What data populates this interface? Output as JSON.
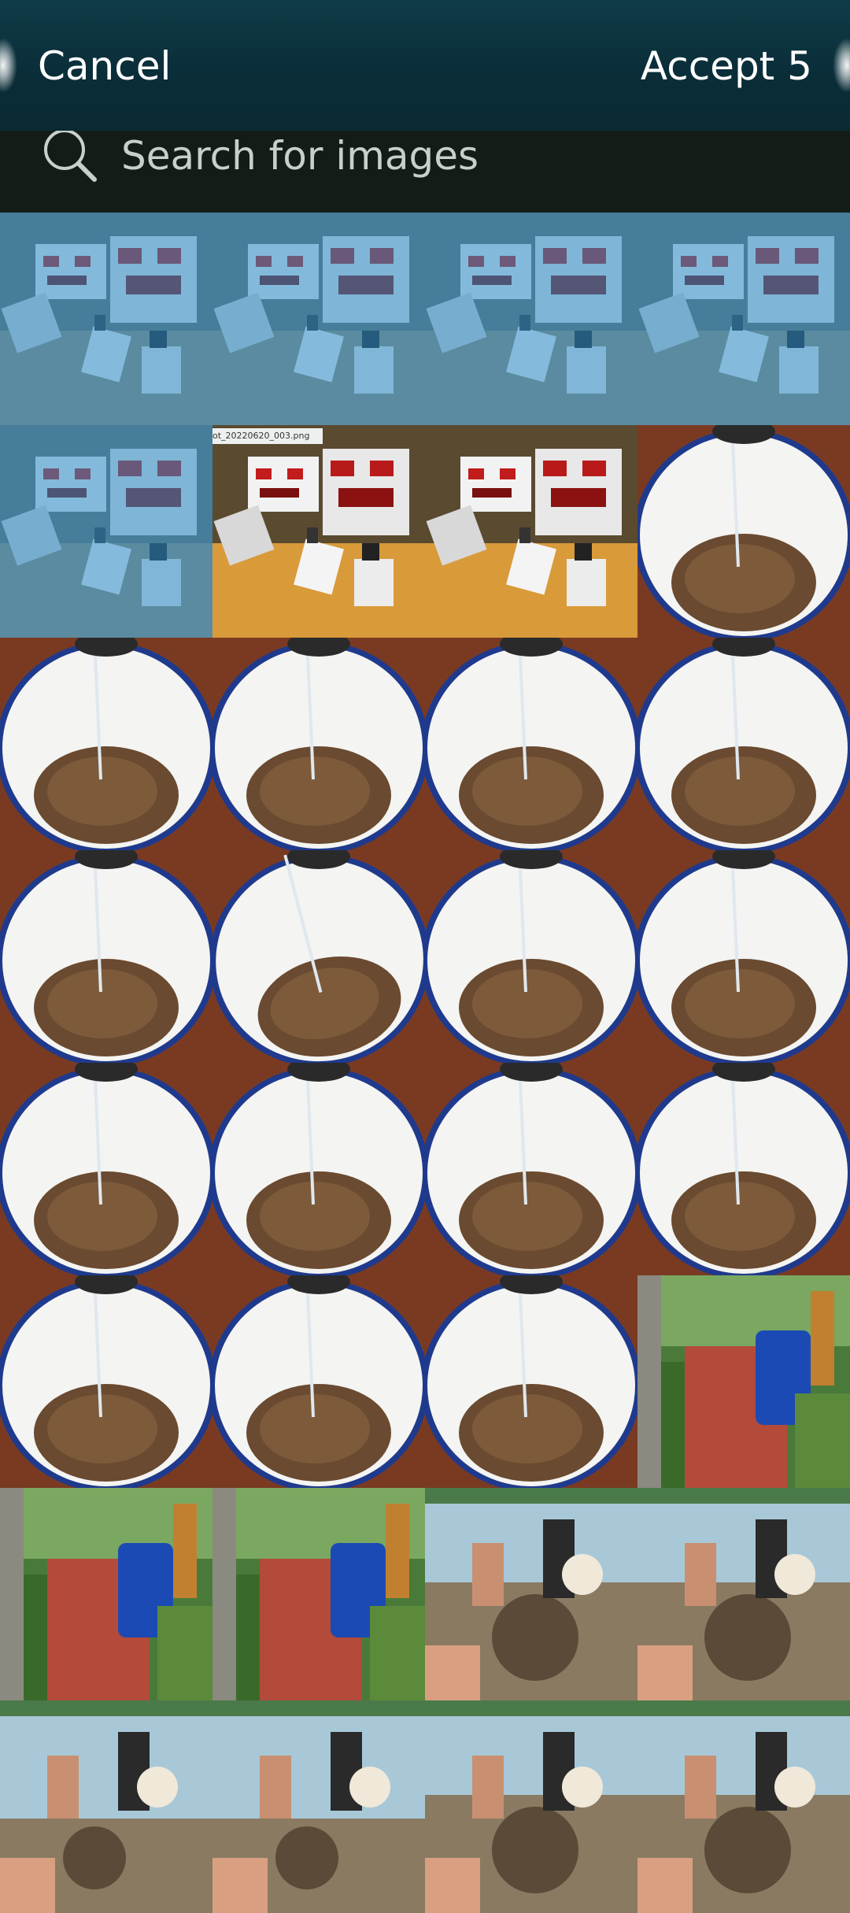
{
  "header": {
    "cancel_label": "Cancel",
    "accept_label": "Accept 5"
  },
  "search": {
    "placeholder": "Search for images",
    "value": ""
  },
  "colors": {
    "selection_overlay": "#2a8cc8",
    "header_bg": "#0f3b48",
    "search_bg": "#141c18"
  },
  "thumbnails": [
    {
      "kind": "lego",
      "selected": true
    },
    {
      "kind": "lego",
      "selected": true
    },
    {
      "kind": "lego",
      "selected": true
    },
    {
      "kind": "lego",
      "selected": true
    },
    {
      "kind": "lego",
      "selected": true
    },
    {
      "kind": "lego-screenshot",
      "selected": false,
      "caption": "ot_20220620_003.png"
    },
    {
      "kind": "lego-screenshot",
      "selected": false
    },
    {
      "kind": "bucket",
      "selected": false
    },
    {
      "kind": "bucket",
      "selected": false
    },
    {
      "kind": "bucket",
      "selected": false
    },
    {
      "kind": "bucket",
      "selected": false
    },
    {
      "kind": "bucket",
      "selected": false
    },
    {
      "kind": "bucket",
      "selected": false
    },
    {
      "kind": "bucket-tilted",
      "selected": false
    },
    {
      "kind": "bucket",
      "selected": false
    },
    {
      "kind": "bucket",
      "selected": false
    },
    {
      "kind": "bucket",
      "selected": false
    },
    {
      "kind": "bucket",
      "selected": false
    },
    {
      "kind": "bucket",
      "selected": false
    },
    {
      "kind": "bucket",
      "selected": false
    },
    {
      "kind": "bucket",
      "selected": false
    },
    {
      "kind": "bucket",
      "selected": false
    },
    {
      "kind": "bucket",
      "selected": false
    },
    {
      "kind": "garden",
      "selected": false
    },
    {
      "kind": "garden",
      "selected": false
    },
    {
      "kind": "garden",
      "selected": false
    },
    {
      "kind": "beach-sand",
      "selected": false
    },
    {
      "kind": "beach-sand",
      "selected": false
    },
    {
      "kind": "beach",
      "selected": false
    },
    {
      "kind": "beach",
      "selected": false
    },
    {
      "kind": "beach-sand",
      "selected": false
    },
    {
      "kind": "beach-sand",
      "selected": false
    }
  ]
}
